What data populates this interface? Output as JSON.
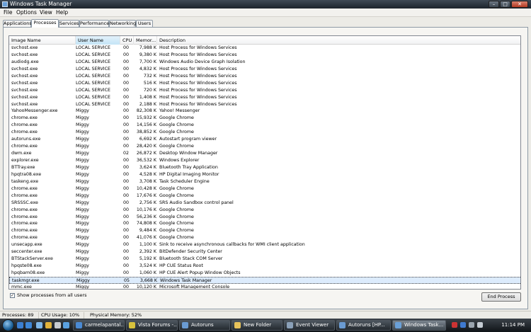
{
  "window": {
    "title": "Windows Task Manager",
    "min_glyph": "–",
    "max_glyph": "□",
    "close_glyph": "✕"
  },
  "menu": [
    "File",
    "Options",
    "View",
    "Help"
  ],
  "tabs": [
    "Applications",
    "Processes",
    "Services",
    "Performance",
    "Networking",
    "Users"
  ],
  "active_tab": "Processes",
  "columns": {
    "image": "Image Name",
    "user": "User Name",
    "cpu": "CPU",
    "mem": "Memor...",
    "desc": "Description",
    "sort_arrow": "^"
  },
  "processes": [
    {
      "name": "svchost.exe",
      "user": "LOCAL SERVICE",
      "cpu": "00",
      "mem": "7,988 K",
      "desc": "Host Process for Windows Services"
    },
    {
      "name": "svchost.exe",
      "user": "LOCAL SERVICE",
      "cpu": "00",
      "mem": "9,380 K",
      "desc": "Host Process for Windows Services"
    },
    {
      "name": "audiodg.exe",
      "user": "LOCAL SERVICE",
      "cpu": "00",
      "mem": "7,700 K",
      "desc": "Windows Audio Device Graph Isolation"
    },
    {
      "name": "svchost.exe",
      "user": "LOCAL SERVICE",
      "cpu": "00",
      "mem": "4,832 K",
      "desc": "Host Process for Windows Services"
    },
    {
      "name": "svchost.exe",
      "user": "LOCAL SERVICE",
      "cpu": "00",
      "mem": "732 K",
      "desc": "Host Process for Windows Services"
    },
    {
      "name": "svchost.exe",
      "user": "LOCAL SERVICE",
      "cpu": "00",
      "mem": "516 K",
      "desc": "Host Process for Windows Services"
    },
    {
      "name": "svchost.exe",
      "user": "LOCAL SERVICE",
      "cpu": "00",
      "mem": "720 K",
      "desc": "Host Process for Windows Services"
    },
    {
      "name": "svchost.exe",
      "user": "LOCAL SERVICE",
      "cpu": "00",
      "mem": "1,408 K",
      "desc": "Host Process for Windows Services"
    },
    {
      "name": "svchost.exe",
      "user": "LOCAL SERVICE",
      "cpu": "00",
      "mem": "2,188 K",
      "desc": "Host Process for Windows Services"
    },
    {
      "name": "YahooMessenger.exe",
      "user": "Miggy",
      "cpu": "00",
      "mem": "82,308 K",
      "desc": "Yahoo! Messenger"
    },
    {
      "name": "chrome.exe",
      "user": "Miggy",
      "cpu": "00",
      "mem": "15,932 K",
      "desc": "Google Chrome"
    },
    {
      "name": "chrome.exe",
      "user": "Miggy",
      "cpu": "00",
      "mem": "14,156 K",
      "desc": "Google Chrome"
    },
    {
      "name": "chrome.exe",
      "user": "Miggy",
      "cpu": "00",
      "mem": "38,852 K",
      "desc": "Google Chrome"
    },
    {
      "name": "autoruns.exe",
      "user": "Miggy",
      "cpu": "00",
      "mem": "6,692 K",
      "desc": "Autostart program viewer"
    },
    {
      "name": "chrome.exe",
      "user": "Miggy",
      "cpu": "00",
      "mem": "28,420 K",
      "desc": "Google Chrome"
    },
    {
      "name": "dwm.exe",
      "user": "Miggy",
      "cpu": "02",
      "mem": "26,872 K",
      "desc": "Desktop Window Manager"
    },
    {
      "name": "explorer.exe",
      "user": "Miggy",
      "cpu": "00",
      "mem": "36,532 K",
      "desc": "Windows Explorer"
    },
    {
      "name": "BTTray.exe",
      "user": "Miggy",
      "cpu": "00",
      "mem": "3,624 K",
      "desc": "Bluetooth Tray Application"
    },
    {
      "name": "hpqtra08.exe",
      "user": "Miggy",
      "cpu": "00",
      "mem": "4,528 K",
      "desc": "HP Digital Imaging Monitor"
    },
    {
      "name": "taskeng.exe",
      "user": "Miggy",
      "cpu": "00",
      "mem": "3,708 K",
      "desc": "Task Scheduler Engine"
    },
    {
      "name": "chrome.exe",
      "user": "Miggy",
      "cpu": "00",
      "mem": "10,428 K",
      "desc": "Google Chrome"
    },
    {
      "name": "chrome.exe",
      "user": "Miggy",
      "cpu": "00",
      "mem": "17,676 K",
      "desc": "Google Chrome"
    },
    {
      "name": "SRSSSC.exe",
      "user": "Miggy",
      "cpu": "00",
      "mem": "2,756 K",
      "desc": "SRS Audio Sandbox control panel"
    },
    {
      "name": "chrome.exe",
      "user": "Miggy",
      "cpu": "00",
      "mem": "10,176 K",
      "desc": "Google Chrome"
    },
    {
      "name": "chrome.exe",
      "user": "Miggy",
      "cpu": "00",
      "mem": "56,236 K",
      "desc": "Google Chrome"
    },
    {
      "name": "chrome.exe",
      "user": "Miggy",
      "cpu": "00",
      "mem": "74,808 K",
      "desc": "Google Chrome"
    },
    {
      "name": "chrome.exe",
      "user": "Miggy",
      "cpu": "00",
      "mem": "9,484 K",
      "desc": "Google Chrome"
    },
    {
      "name": "chrome.exe",
      "user": "Miggy",
      "cpu": "00",
      "mem": "41,076 K",
      "desc": "Google Chrome"
    },
    {
      "name": "unsecapp.exe",
      "user": "Miggy",
      "cpu": "00",
      "mem": "1,100 K",
      "desc": "Sink to receive asynchronous callbacks for WMI client application"
    },
    {
      "name": "seccenter.exe",
      "user": "Miggy",
      "cpu": "00",
      "mem": "2,392 K",
      "desc": "BitDefender Security Center"
    },
    {
      "name": "BTStackServer.exe",
      "user": "Miggy",
      "cpu": "00",
      "mem": "5,192 K",
      "desc": "Bluetooth Stack COM Server"
    },
    {
      "name": "hpqste08.exe",
      "user": "Miggy",
      "cpu": "00",
      "mem": "3,524 K",
      "desc": "HP CUE Status Root"
    },
    {
      "name": "hpqbam08.exe",
      "user": "Miggy",
      "cpu": "00",
      "mem": "1,060 K",
      "desc": "HP CUE Alert Popup Window Objects"
    },
    {
      "name": "taskmgr.exe",
      "user": "Miggy",
      "cpu": "05",
      "mem": "3,668 K",
      "desc": "Windows Task Manager",
      "selected": true
    },
    {
      "name": "mmc.exe",
      "user": "Miggy",
      "cpu": "00",
      "mem": "10,120 K",
      "desc": "Microsoft Management Console"
    }
  ],
  "show_all_label": "Show processes from all users",
  "show_all_checked": true,
  "end_process_label": "End Process",
  "status": {
    "processes": "Processes: 89",
    "cpu": "CPU Usage: 10%",
    "memory": "Physical Memory: 52%"
  },
  "taskbar": {
    "items": [
      {
        "label": "carmelapantal..."
      },
      {
        "label": "Vista Forums -..."
      },
      {
        "label": "Autoruns"
      },
      {
        "label": "New Folder"
      },
      {
        "label": "Event Viewer"
      },
      {
        "label": "Autoruns [HP..."
      },
      {
        "label": "Windows Task...",
        "active": true
      }
    ],
    "clock": "11:14 PM"
  }
}
